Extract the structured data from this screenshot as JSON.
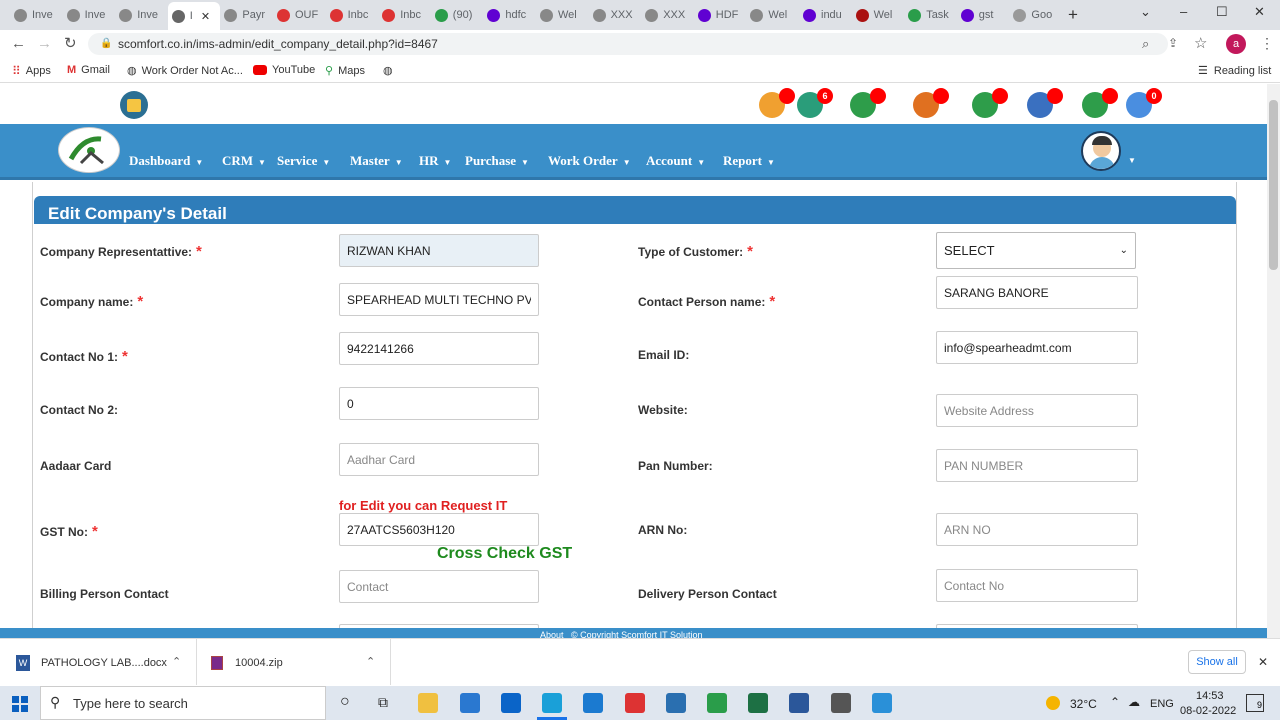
{
  "browser": {
    "tabs": [
      "Inve",
      "Inve",
      "Inve",
      "I",
      "Payr",
      "OUF",
      "Inbc",
      "Inbc",
      "(90)",
      "hdfc",
      "Wel",
      "XXX",
      "XXX",
      "HDF",
      "Wel",
      "indu",
      "Wel",
      "Task",
      "gst",
      "Goo"
    ],
    "url": "scomfort.co.in/ims-admin/edit_company_detail.php?id=8467",
    "bookmarks": [
      "Apps",
      "Gmail",
      "Work Order Not Ac...",
      "YouTube",
      "Maps"
    ],
    "reading_list": "Reading list"
  },
  "topbar": {
    "badges": [
      "",
      "6",
      "",
      "",
      "",
      "",
      "",
      "0"
    ]
  },
  "nav": {
    "items": [
      "Dashboard",
      "CRM",
      "Service",
      "Master",
      "HR",
      "Purchase",
      "Work Order",
      "Account",
      "Report"
    ]
  },
  "form": {
    "title": "Edit Company's Detail",
    "left": [
      {
        "label": "Company Representattive:",
        "required": true,
        "value": "RIZWAN KHAN",
        "placeholder": ""
      },
      {
        "label": "Company name:",
        "required": true,
        "value": "SPEARHEAD MULTI TECHNO PVT",
        "placeholder": ""
      },
      {
        "label": "Contact No 1:",
        "required": true,
        "value": "9422141266",
        "placeholder": ""
      },
      {
        "label": "Contact No 2:",
        "required": false,
        "value": "0",
        "placeholder": ""
      },
      {
        "label": "Aadaar Card",
        "required": false,
        "value": "",
        "placeholder": "Aadhar Card"
      },
      {
        "label": "GST No:",
        "required": true,
        "value": "27AATCS5603H120",
        "placeholder": ""
      },
      {
        "label": "Billing Person Contact",
        "required": false,
        "value": "",
        "placeholder": "Contact"
      }
    ],
    "right": [
      {
        "label": "Type of Customer:",
        "required": true,
        "value": "SELECT",
        "placeholder": ""
      },
      {
        "label": "Contact Person name:",
        "required": true,
        "value": "SARANG BANORE",
        "placeholder": ""
      },
      {
        "label": "Email ID:",
        "required": false,
        "value": "info@spearheadmt.com",
        "placeholder": ""
      },
      {
        "label": "Website:",
        "required": false,
        "value": "",
        "placeholder": "Website Address"
      },
      {
        "label": "Pan Number:",
        "required": false,
        "value": "",
        "placeholder": "PAN NUMBER"
      },
      {
        "label": "ARN No:",
        "required": false,
        "value": "",
        "placeholder": "ARN NO"
      },
      {
        "label": "Delivery Person Contact",
        "required": false,
        "value": "",
        "placeholder": "Contact No"
      }
    ],
    "gst_note": "for Edit you can Request IT",
    "gst_check": "Cross Check GST",
    "required_mark": "*"
  },
  "footer": "About   © Copyright Scomfort IT Solution",
  "downloads": {
    "items": [
      "PATHOLOGY LAB....docx",
      "10004.zip"
    ],
    "show_all": "Show all"
  },
  "taskbar": {
    "search": "Type here to search",
    "temp": "32°C",
    "lang": "ENG",
    "time": "14:53",
    "date": "08-02-2022",
    "notif": "9"
  },
  "colors": {
    "nav": "#3a8fc9",
    "header": "#2f7dba",
    "required": "#e33",
    "gst_check": "#1e8a1e",
    "note": "#e02020"
  }
}
